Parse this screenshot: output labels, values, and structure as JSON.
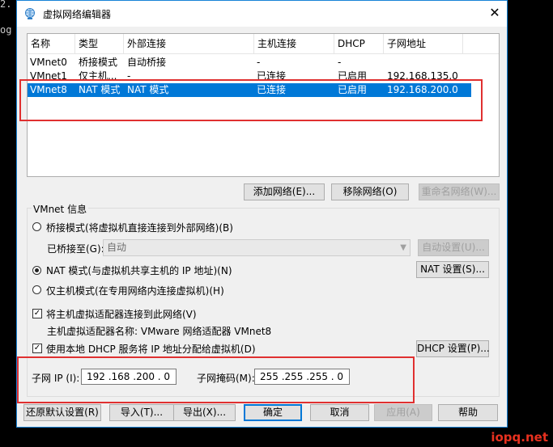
{
  "background": {
    "line1": "2.",
    "line2": "og"
  },
  "window": {
    "title": "虚拟网络编辑器",
    "close_glyph": "✕"
  },
  "table": {
    "columns": [
      "名称",
      "类型",
      "外部连接",
      "主机连接",
      "DHCP",
      "子网地址"
    ],
    "rows": [
      {
        "name": "VMnet0",
        "type": "桥接模式",
        "external": "自动桥接",
        "host": "-",
        "dhcp": "-",
        "subnet": ""
      },
      {
        "name": "VMnet1",
        "type": "仅主机...",
        "external": "-",
        "host": "已连接",
        "dhcp": "已启用",
        "subnet": "192.168.135.0"
      },
      {
        "name": "VMnet8",
        "type": "NAT 模式",
        "external": "NAT 模式",
        "host": "已连接",
        "dhcp": "已启用",
        "subnet": "192.168.200.0"
      }
    ]
  },
  "buttons": {
    "add_network": "添加网络(E)...",
    "remove_network": "移除网络(O)",
    "rename_network": "重命名网络(W)...",
    "auto_settings": "自动设置(U)...",
    "nat_settings": "NAT 设置(S)...",
    "dhcp_settings": "DHCP 设置(P)...",
    "restore_defaults": "还原默认设置(R)",
    "import": "导入(T)...",
    "export": "导出(X)...",
    "ok": "确定",
    "cancel": "取消",
    "apply": "应用(A)",
    "help": "帮助"
  },
  "vmnet_info": {
    "group_label": "VMnet 信息",
    "bridge_mode_label": "桥接模式(将虚拟机直接连接到外部网络)(B)",
    "bridged_to_label": "已桥接至(G):",
    "bridged_to_value": "自动",
    "nat_mode_label": "NAT 模式(与虚拟机共享主机的 IP 地址)(N)",
    "host_only_label": "仅主机模式(在专用网络内连接虚拟机)(H)",
    "connect_adapter_label": "将主机虚拟适配器连接到此网络(V)",
    "adapter_name_label": "主机虚拟适配器名称: VMware 网络适配器 VMnet8",
    "use_dhcp_label": "使用本地 DHCP 服务将 IP 地址分配给虚拟机(D)",
    "subnet_ip_label": "子网 IP (I):",
    "subnet_ip_value": "192 .168 .200 . 0",
    "subnet_mask_label": "子网掩码(M):",
    "subnet_mask_value": "255 .255 .255 . 0",
    "selected_mode": "nat",
    "connect_adapter_checked": true,
    "use_dhcp_checked": true
  },
  "watermark": "iopq.net",
  "colors": {
    "accent": "#0078d7",
    "highlight_box": "#e03030",
    "watermark": "#e8311f"
  }
}
